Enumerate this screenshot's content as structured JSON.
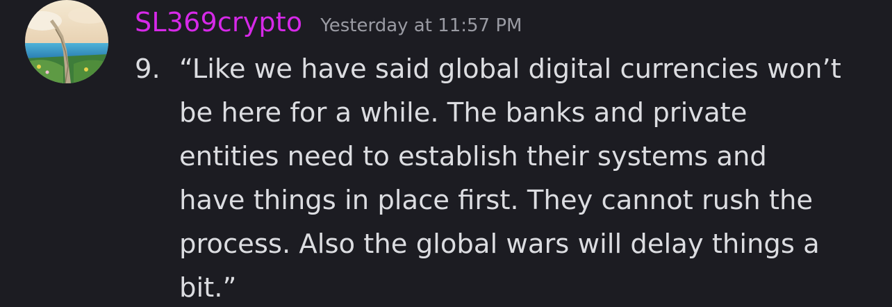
{
  "message": {
    "author": {
      "name": "SL369crypto",
      "name_color": "#d629e8"
    },
    "timestamp": "Yesterday at 11:57 PM",
    "list_number": "9.",
    "lines": [
      "“Like we have said global digital currencies won’t",
      "be here for a while. The banks and private",
      "entities need to establish their systems and",
      "have things in place first. They cannot rush the",
      "process. Also the global wars will delay things a",
      "bit.”"
    ]
  },
  "colors": {
    "background": "#1c1c22",
    "text": "#dcdde1",
    "timestamp": "#9a9ba3"
  }
}
